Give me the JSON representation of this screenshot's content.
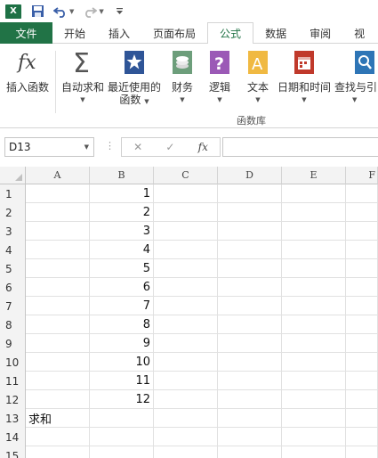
{
  "window": {
    "app_icon": "excel-logo-icon",
    "quick_access": [
      "save-icon",
      "undo-icon",
      "redo-icon",
      "customize-qat-icon"
    ]
  },
  "tabs": [
    {
      "label": "文件",
      "kind": "file"
    },
    {
      "label": "开始"
    },
    {
      "label": "插入"
    },
    {
      "label": "页面布局"
    },
    {
      "label": "公式",
      "active": true
    },
    {
      "label": "数据"
    },
    {
      "label": "审阅"
    },
    {
      "label": "视"
    }
  ],
  "ribbon": {
    "insert_function": "插入函数",
    "autosum": "自动求和",
    "recent_line1": "最近使用的",
    "recent_line2": "函数",
    "financial": "财务",
    "logical": "逻辑",
    "text": "文本",
    "datetime": "日期和时间",
    "lookup": "查找与引",
    "group_label": "函数库"
  },
  "formula_bar": {
    "name_box": "D13",
    "cancel": "✕",
    "enter": "✓",
    "fx": "fx",
    "formula": ""
  },
  "colors": {
    "excel_green": "#217346",
    "header_bg": "#f3f3f3",
    "gridline": "#e1e1e1"
  },
  "sheet": {
    "columns": [
      "A",
      "B",
      "C",
      "D",
      "E",
      "F"
    ],
    "rows": [
      {
        "n": "1",
        "a": "",
        "b": "1"
      },
      {
        "n": "2",
        "a": "",
        "b": "2"
      },
      {
        "n": "3",
        "a": "",
        "b": "3"
      },
      {
        "n": "4",
        "a": "",
        "b": "4"
      },
      {
        "n": "5",
        "a": "",
        "b": "5"
      },
      {
        "n": "6",
        "a": "",
        "b": "6"
      },
      {
        "n": "7",
        "a": "",
        "b": "7"
      },
      {
        "n": "8",
        "a": "",
        "b": "8"
      },
      {
        "n": "9",
        "a": "",
        "b": "9"
      },
      {
        "n": "10",
        "a": "",
        "b": "10"
      },
      {
        "n": "11",
        "a": "",
        "b": "11"
      },
      {
        "n": "12",
        "a": "",
        "b": "12"
      },
      {
        "n": "13",
        "a": "求和",
        "b": ""
      },
      {
        "n": "14",
        "a": "",
        "b": ""
      },
      {
        "n": "15",
        "a": "",
        "b": ""
      }
    ]
  }
}
